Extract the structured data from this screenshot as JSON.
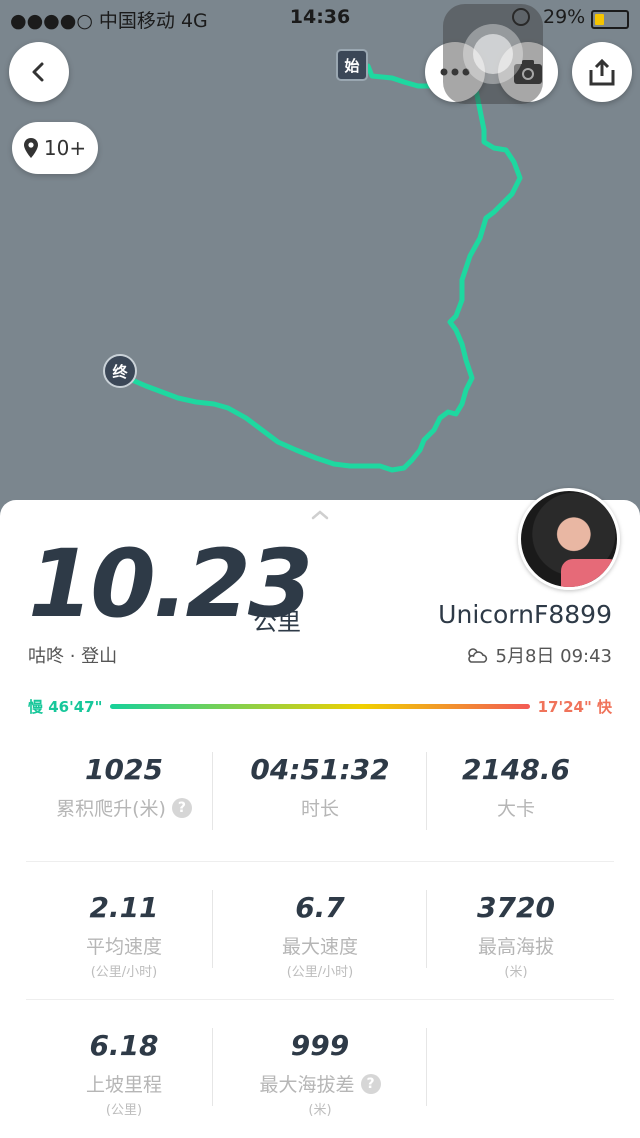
{
  "status_bar": {
    "carrier": "●●●●○ 中国移动  4G",
    "time": "14:36",
    "battery": "29%",
    "battery_level": 0.29
  },
  "map": {
    "poi_count": "10+",
    "start_marker": "始",
    "end_marker": "终",
    "route_color": "#1ed8a0"
  },
  "summary": {
    "distance": "10.23",
    "distance_unit": "公里",
    "activity": "咕咚 · 登山",
    "username": "UnicornF8899",
    "date": "5月8日 09:43",
    "pace_slow": "慢 46'47\"",
    "pace_fast": "17'24\" 快"
  },
  "stats": [
    {
      "value": "1025",
      "label": "累积爬升(米)",
      "help": "?"
    },
    {
      "value": "04:51:32",
      "label": "时长"
    },
    {
      "value": "2148.6",
      "label": "大卡"
    },
    {
      "value": "2.11",
      "label": "平均速度",
      "sub": "(公里/小时)"
    },
    {
      "value": "6.7",
      "label": "最大速度",
      "sub": "(公里/小时)"
    },
    {
      "value": "3720",
      "label": "最高海拔",
      "sub": "(米)"
    },
    {
      "value": "6.18",
      "label": "上坡里程",
      "sub": "(公里)"
    },
    {
      "value": "999",
      "label": "最大海拔差",
      "sub": "(米)",
      "help": "?"
    }
  ],
  "colors": {
    "primary_text": "#2e3a47",
    "slow": "#17c79a",
    "fast": "#f0735a"
  }
}
